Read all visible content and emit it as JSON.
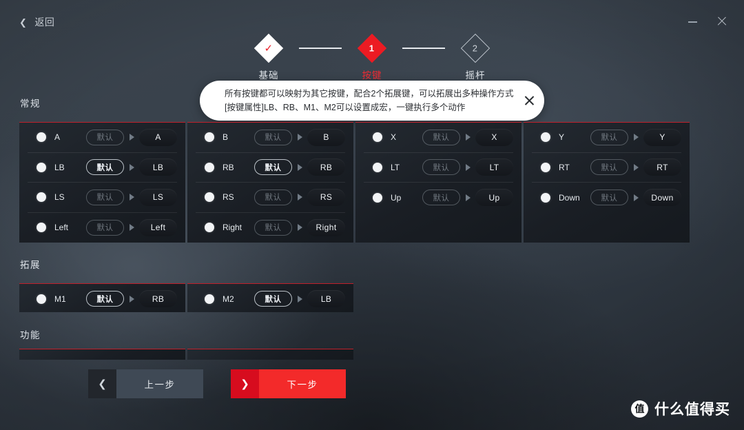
{
  "window": {
    "back_label": "返回",
    "back_icon": "chevron-left-icon",
    "minimize_icon": "minimize-icon",
    "close_icon": "close-icon"
  },
  "stepper": {
    "steps": [
      {
        "marker": "✓",
        "label": "基础",
        "state": "done"
      },
      {
        "marker": "1",
        "label": "按键",
        "state": "active"
      },
      {
        "marker": "2",
        "label": "摇杆",
        "state": "todo"
      }
    ]
  },
  "tooltip": {
    "line1": "所有按键都可以映射为其它按键，配合2个拓展键，可以拓展出多种操作方式",
    "line2": "[按键属性]LB、RB、M1、M2可以设置成宏，一键执行多个动作",
    "close_icon": "close-icon"
  },
  "sections": {
    "general": {
      "label": "常规"
    },
    "expand": {
      "label": "拓展"
    },
    "function": {
      "label": "功能"
    }
  },
  "general_columns": [
    {
      "rows": [
        {
          "source": "A",
          "mode": "默认",
          "mode_active": false,
          "dest": "A"
        },
        {
          "source": "LB",
          "mode": "默认",
          "mode_active": true,
          "dest": "LB"
        },
        {
          "source": "LS",
          "mode": "默认",
          "mode_active": false,
          "dest": "LS"
        },
        {
          "source": "Left",
          "mode": "默认",
          "mode_active": false,
          "dest": "Left"
        }
      ]
    },
    {
      "rows": [
        {
          "source": "B",
          "mode": "默认",
          "mode_active": false,
          "dest": "B"
        },
        {
          "source": "RB",
          "mode": "默认",
          "mode_active": true,
          "dest": "RB"
        },
        {
          "source": "RS",
          "mode": "默认",
          "mode_active": false,
          "dest": "RS"
        },
        {
          "source": "Right",
          "mode": "默认",
          "mode_active": false,
          "dest": "Right"
        }
      ]
    },
    {
      "rows": [
        {
          "source": "X",
          "mode": "默认",
          "mode_active": false,
          "dest": "X"
        },
        {
          "source": "LT",
          "mode": "默认",
          "mode_active": false,
          "dest": "LT"
        },
        {
          "source": "Up",
          "mode": "默认",
          "mode_active": false,
          "dest": "Up"
        }
      ]
    },
    {
      "rows": [
        {
          "source": "Y",
          "mode": "默认",
          "mode_active": false,
          "dest": "Y"
        },
        {
          "source": "RT",
          "mode": "默认",
          "mode_active": false,
          "dest": "RT"
        },
        {
          "source": "Down",
          "mode": "默认",
          "mode_active": false,
          "dest": "Down"
        }
      ]
    }
  ],
  "expand_columns": [
    {
      "rows": [
        {
          "source": "M1",
          "mode": "默认",
          "mode_active": true,
          "dest": "RB"
        }
      ]
    },
    {
      "rows": [
        {
          "source": "M2",
          "mode": "默认",
          "mode_active": true,
          "dest": "LB"
        }
      ]
    }
  ],
  "function_columns": [
    {
      "rows": []
    },
    {
      "rows": []
    }
  ],
  "nav": {
    "prev": {
      "label": "上一步",
      "icon": "chevron-left-icon"
    },
    "next": {
      "label": "下一步",
      "icon": "chevron-right-icon"
    }
  },
  "watermark": {
    "logo": "值",
    "text": "什么值得买"
  },
  "colors": {
    "accent_red": "#ec1b23",
    "next_button_red": "#f32a2a",
    "panel_top_border": "#c0202b",
    "panel_bg": "#1a1e24",
    "text_primary": "#e6eaee"
  }
}
